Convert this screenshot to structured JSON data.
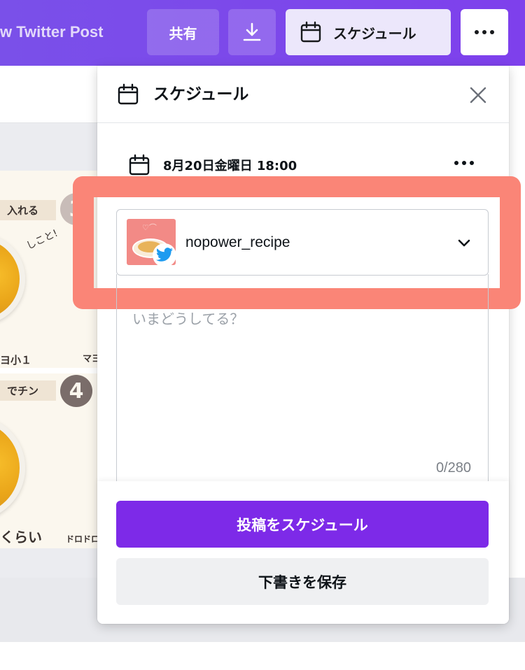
{
  "topbar": {
    "doc_title": "w Twitter Post",
    "share_label": "共有",
    "download_icon": "download-icon",
    "schedule_label": "スケジュール",
    "more_icon": "more-horizontal-icon",
    "accent_color": "#7d2ae8"
  },
  "canvas": {
    "label_step3": "入れる",
    "label_step4": "でチン",
    "step3_number": "3",
    "step4_number": "4",
    "handwritten_text": "しこと!",
    "caption_left": "ヨ小１",
    "caption_right": "マヨ",
    "caption_bottom": "くらい",
    "caption_bottom_right": "ドロドロ"
  },
  "panel": {
    "title": "スケジュール",
    "close_icon": "close-icon",
    "schedule_datetime": "8月20日金曜日 18:00",
    "account": {
      "name": "nopower_recipe",
      "network_icon": "twitter-icon"
    },
    "tweet_placeholder": "いまどうしてる？",
    "char_count": "0/280",
    "schedule_button": "投稿をスケジュール",
    "save_draft_button": "下書きを保存"
  },
  "highlight_color": "#fa8577"
}
